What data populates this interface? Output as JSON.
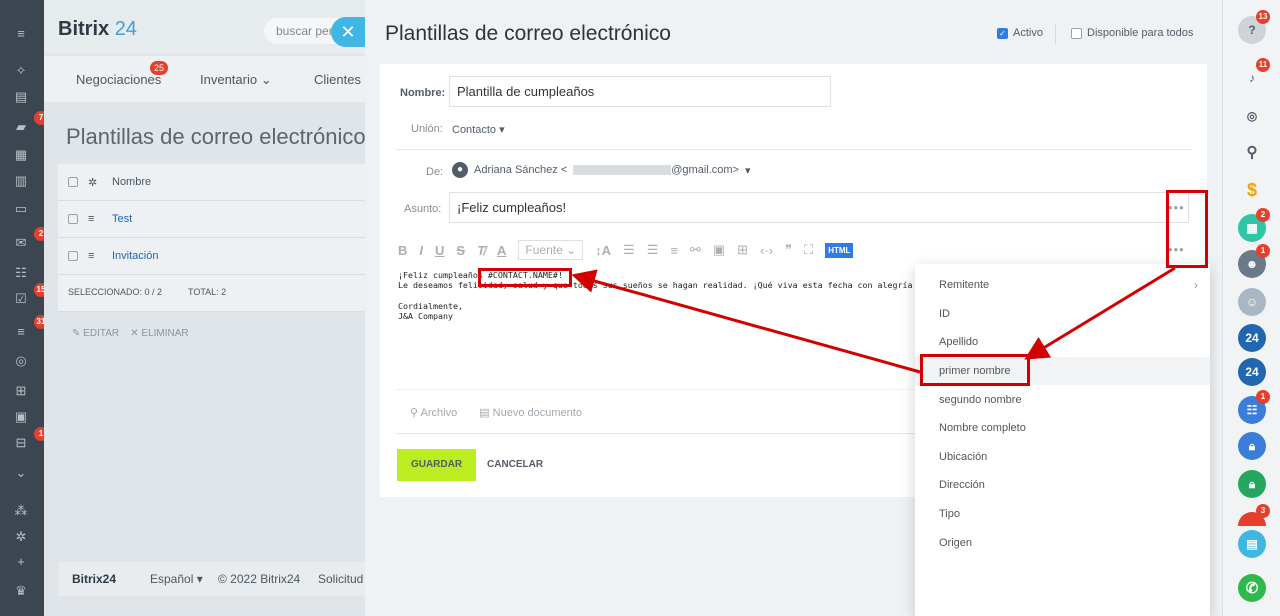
{
  "app": {
    "logo_text": "Bitrix",
    "logo_num": "24",
    "search_placeholder": "buscar per"
  },
  "left_rail": {
    "badges": [
      "7",
      "2",
      "15",
      "31",
      "1"
    ]
  },
  "background": {
    "menu": [
      {
        "label": "Negociaciones",
        "badge": "25"
      },
      {
        "label": "Inventario ⌄",
        "badge": ""
      },
      {
        "label": "Clientes",
        "badge": ""
      }
    ],
    "title": "Plantillas de correo electrónico",
    "table_header": "Nombre",
    "rows": [
      "Test",
      "Invitación"
    ],
    "selected": "SELECCIONADO: 0 / 2",
    "total": "TOTAL: 2",
    "edit": "EDITAR",
    "delete": "ELIMINAR",
    "footer": {
      "brand": "Bitrix24",
      "lang": "Español ▾",
      "copyright": "© 2022 Bitrix24",
      "request": "Solicitud"
    }
  },
  "panel": {
    "title": "Plantillas de correo electrónico",
    "active_label": "Activo",
    "available_label": "Disponible para todos",
    "name_label": "Nombre:",
    "name_value": "Plantilla de cumpleaños",
    "union_label": "Unión:",
    "union_value": "Contacto",
    "from_label": "De:",
    "from_name": "Adriana Sánchez <",
    "from_domain": "@gmail.com>",
    "subject_label": "Asunto:",
    "subject_value": "¡Feliz cumpleaños!",
    "toolbar_font": "Fuente",
    "toolbar_html": "HTML",
    "body": {
      "line1_start": "¡Feliz cumpleaños ",
      "line1_tag": "#CONTACT.NAME#",
      "line1_end": "!",
      "line2": "Le deseamos felicidad, salud y que todos sus sueños se hagan realidad. ¡Qué viva esta fecha con alegría y tenga una",
      "line4": "Cordialmente,",
      "line5": "J&A Company"
    },
    "attach_file": "Archivo",
    "new_document": "Nuevo documento",
    "save": "GUARDAR",
    "cancel": "CANCELAR"
  },
  "dropdown": {
    "items": [
      "Remitente",
      "ID",
      "Apellido",
      "primer nombre",
      "segundo nombre",
      "Nombre completo",
      "Ubicación",
      "Dirección",
      "Tipo",
      "Origen"
    ]
  },
  "right_rail": {
    "badges": [
      "13",
      "11",
      "2",
      "1",
      "1",
      "3"
    ],
    "num_label": "24"
  },
  "colors": {
    "annotation_red": "#d20000",
    "save_green": "#bbed21",
    "accent_blue": "#2f7ce6"
  }
}
